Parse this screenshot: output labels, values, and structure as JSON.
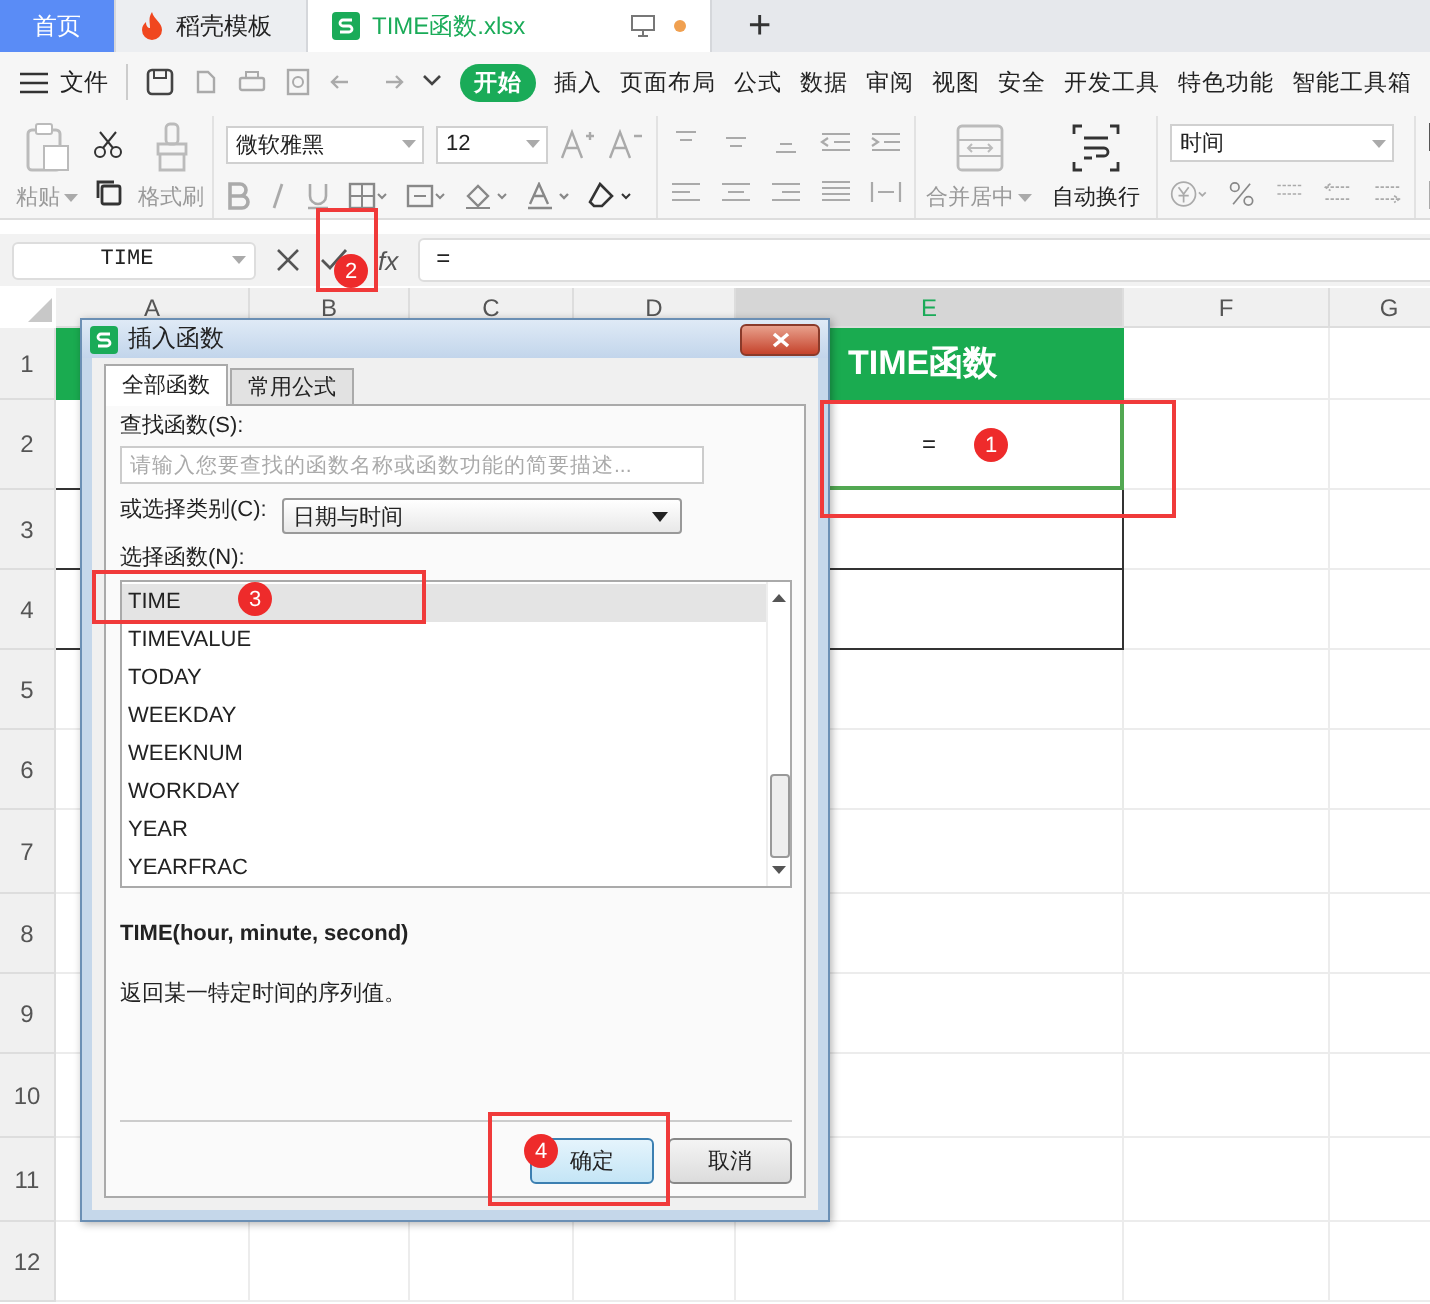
{
  "app_tabs": [
    {
      "label": "首页",
      "kind": "home",
      "selected": false
    },
    {
      "label": "稻壳模板",
      "kind": "template",
      "selected": false
    },
    {
      "label": "TIME函数.xlsx",
      "kind": "sheet",
      "selected": true
    }
  ],
  "new_tab": "+",
  "menu": {
    "file": "文件",
    "items": [
      {
        "label": "开始",
        "selected": true
      },
      {
        "label": "插入",
        "selected": false
      },
      {
        "label": "页面布局",
        "selected": false
      },
      {
        "label": "公式",
        "selected": false
      },
      {
        "label": "数据",
        "selected": false
      },
      {
        "label": "审阅",
        "selected": false
      },
      {
        "label": "视图",
        "selected": false
      },
      {
        "label": "安全",
        "selected": false
      },
      {
        "label": "开发工具",
        "selected": false
      },
      {
        "label": "特色功能",
        "selected": false
      },
      {
        "label": "智能工具箱",
        "selected": false
      }
    ]
  },
  "ribbon": {
    "paste": "粘贴",
    "format_painter": "格式刷",
    "font": "微软雅黑",
    "font_size": "12",
    "merge": "合并居中",
    "wrap": "自动换行",
    "number_format": "时间"
  },
  "formula_bar": {
    "name_box": "TIME",
    "fx": "fx",
    "value": "="
  },
  "columns": [
    {
      "label": "A",
      "selected": false
    },
    {
      "label": "B",
      "selected": false
    },
    {
      "label": "C",
      "selected": false
    },
    {
      "label": "D",
      "selected": false
    },
    {
      "label": "E",
      "selected": true
    },
    {
      "label": "F",
      "selected": false
    },
    {
      "label": "G",
      "selected": false
    }
  ],
  "rows": [
    "1",
    "2",
    "3",
    "4",
    "5",
    "6",
    "7",
    "8",
    "9",
    "10",
    "11",
    "12"
  ],
  "sheet": {
    "title_cell": "TIME函数",
    "active_cell": "="
  },
  "dialog": {
    "title": "插入函数",
    "tabs": [
      {
        "label": "全部函数",
        "selected": true
      },
      {
        "label": "常用公式",
        "selected": false
      }
    ],
    "search_label": "查找函数(S):",
    "search_placeholder": "请输入您要查找的函数名称或函数功能的简要描述...",
    "category_label": "或选择类别(C):",
    "category": "日期与时间",
    "list_label": "选择函数(N):",
    "functions": [
      {
        "name": "TIME",
        "selected": true
      },
      {
        "name": "TIMEVALUE",
        "selected": false
      },
      {
        "name": "TODAY",
        "selected": false
      },
      {
        "name": "WEEKDAY",
        "selected": false
      },
      {
        "name": "WEEKNUM",
        "selected": false
      },
      {
        "name": "WORKDAY",
        "selected": false
      },
      {
        "name": "YEAR",
        "selected": false
      },
      {
        "name": "YEARFRAC",
        "selected": false
      }
    ],
    "signature": "TIME(hour, minute, second)",
    "description": "返回某一特定时间的序列值。",
    "ok": "确定",
    "cancel": "取消"
  },
  "callouts": [
    {
      "number": "1"
    },
    {
      "number": "2"
    },
    {
      "number": "3"
    },
    {
      "number": "4"
    }
  ]
}
